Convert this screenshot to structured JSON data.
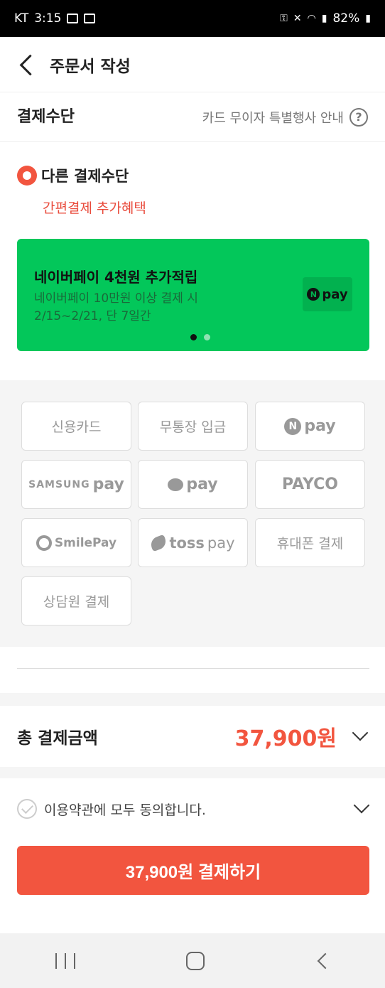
{
  "status_bar": {
    "carrier": "KT",
    "time": "3:15",
    "battery": "82%"
  },
  "app_bar": {
    "title": "주문서 작성"
  },
  "payment_section": {
    "title": "결제수단",
    "info_link": "카드 무이자 특별행사 안내",
    "info_icon_glyph": "?"
  },
  "other_method": {
    "label": "다른 결제수단",
    "benefit": "간편결제 추가혜택"
  },
  "promo_banner": {
    "title": "네이버페이 4천원 추가적립",
    "line1": "네이버페이 10만원 이상 결제 시",
    "line2": "2/15~2/21, 단 7일간",
    "badge_n": "N",
    "badge_pay": "pay",
    "color": "#03c75a"
  },
  "methods": {
    "credit_card": "신용카드",
    "bank_transfer": "무통장 입금",
    "naver_pay_n": "N",
    "naver_pay": "pay",
    "samsung_pay_brand": "SAMSUNG",
    "samsung_pay": "pay",
    "kakao_pay": "pay",
    "payco": "PAYCO",
    "smile_pay": "SmilePay",
    "toss_pay": "toss",
    "toss_pay_suffix": "pay",
    "phone": "휴대폰 결제",
    "counselor": "상담원 결제"
  },
  "total": {
    "label": "총 결제금액",
    "amount": "37,900원"
  },
  "agreement": {
    "text": "이용약관에 모두 동의합니다."
  },
  "pay_button": {
    "label": "37,900원 결제하기",
    "color": "#f2553f"
  }
}
